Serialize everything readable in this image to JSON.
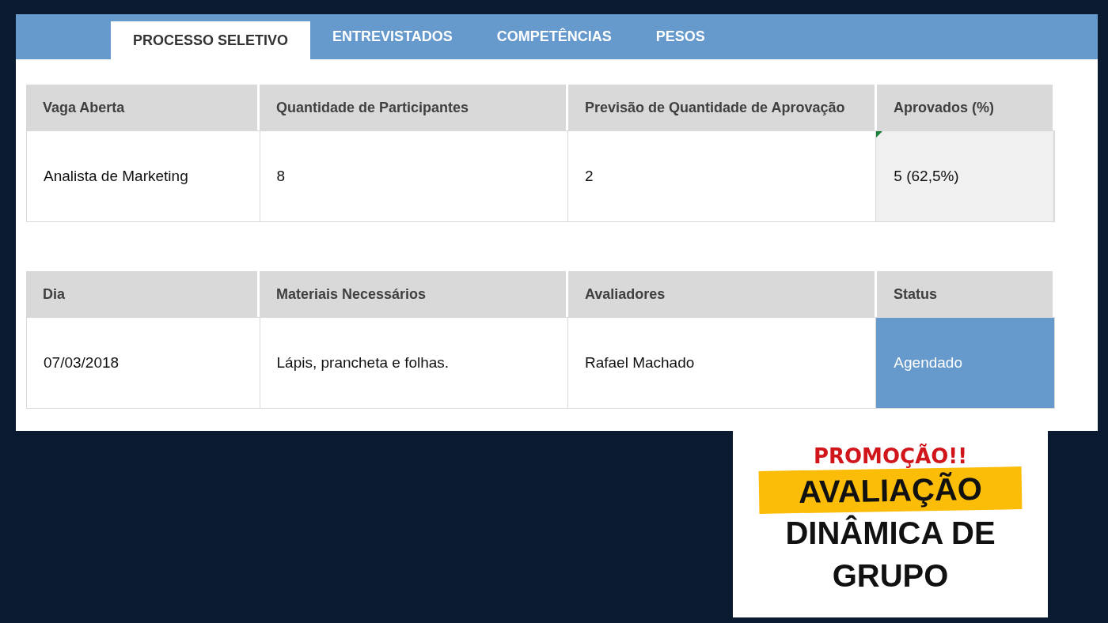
{
  "tabs": [
    {
      "label": "PROCESSO SELETIVO",
      "selected": true
    },
    {
      "label": "ENTREVISTADOS",
      "selected": false
    },
    {
      "label": "COMPETÊNCIAS",
      "selected": false
    },
    {
      "label": "PESOS",
      "selected": false
    }
  ],
  "tables": [
    {
      "columns": [
        "Vaga Aberta",
        "Quantidade de Participantes",
        "Previsão de Quantidade de Aprovação",
        "Aprovados (%)"
      ],
      "rows": [
        [
          {
            "text": "Analista de Marketing",
            "kind": "plain"
          },
          {
            "text": "8",
            "kind": "plain"
          },
          {
            "text": "2",
            "kind": "plain"
          },
          {
            "text": "5 (62,5%)",
            "kind": "computed"
          }
        ]
      ]
    },
    {
      "columns": [
        "Dia",
        "Materiais Necessários",
        "Avaliadores",
        "Status"
      ],
      "rows": [
        [
          {
            "text": "07/03/2018",
            "kind": "plain"
          },
          {
            "text": "Lápis, prancheta e folhas.",
            "kind": "plain"
          },
          {
            "text": "Rafael Machado",
            "kind": "plain"
          },
          {
            "text": "Agendado",
            "kind": "status"
          }
        ]
      ]
    }
  ],
  "promo": {
    "tag": "PROMOÇÃO!!",
    "title_lines": [
      "AVALIAÇÃO",
      "DINÂMICA DE",
      "GRUPO"
    ]
  }
}
